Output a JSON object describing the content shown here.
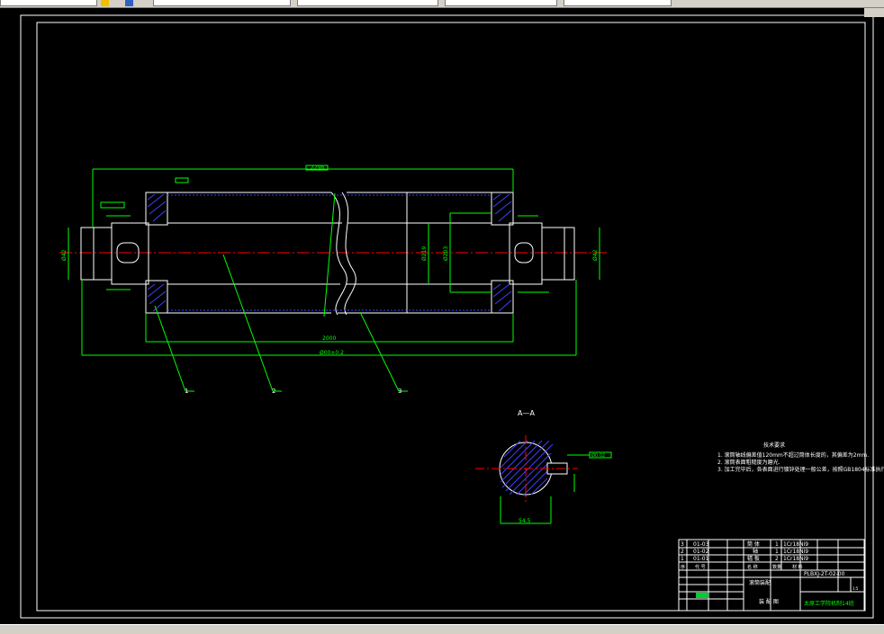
{
  "toolbar": {
    "dropdowns": [
      "",
      "",
      "",
      "",
      ""
    ]
  },
  "drawing": {
    "section_label": "A—A",
    "dims": {
      "overall_length": "2296",
      "roll_length": "2000",
      "shell_length": "Ø00±0.2",
      "dia_shaft_left": "Ø42",
      "dia_shaft_right": "Ø42",
      "dia_roll": "Ø219",
      "dia_inner": "Ø203",
      "section_width": "54.5",
      "section_tol": "Ø0.02"
    },
    "balloons": [
      "1",
      "2",
      "3"
    ],
    "tech_title": "技术要求",
    "tech_notes": [
      "1. 滚筒轴线偏差值120mm不超过筒体长度的，其偏差为2mm.",
      "2. 滚筒表面粗糙度为磨光.",
      "3. 加工完毕后，各表面进行镀锌处理一般公差，按照GB1804标准执行."
    ],
    "bom": [
      {
        "no": "3",
        "code": "01-03",
        "name": "筒  体",
        "qty": "1",
        "material": "1Cr18Ni9"
      },
      {
        "no": "2",
        "code": "01-02",
        "name": "轴",
        "qty": "1",
        "material": "1Cr18Ni9"
      },
      {
        "no": "1",
        "code": "01-01",
        "name": "辐  板",
        "qty": "2",
        "material": "1Cr18Ni9"
      }
    ],
    "bom_headers": [
      "序",
      "代  号",
      "名  称",
      "数量",
      "材  料"
    ],
    "title_block": {
      "part_name": "滚筒装配",
      "drawing_no": "PLBXJ-2T-02-00",
      "scale": "1:5",
      "drawing_type": "装 配 图",
      "school": "太原工学院机制14班"
    }
  },
  "colors": {
    "background": "#000000",
    "outline": "#ffffff",
    "dimension": "#00ff00",
    "centerline": "#ff0000",
    "hidden": "#0000ff",
    "hatch": "#4040ff",
    "accent_green_fill": "#00cc33"
  }
}
